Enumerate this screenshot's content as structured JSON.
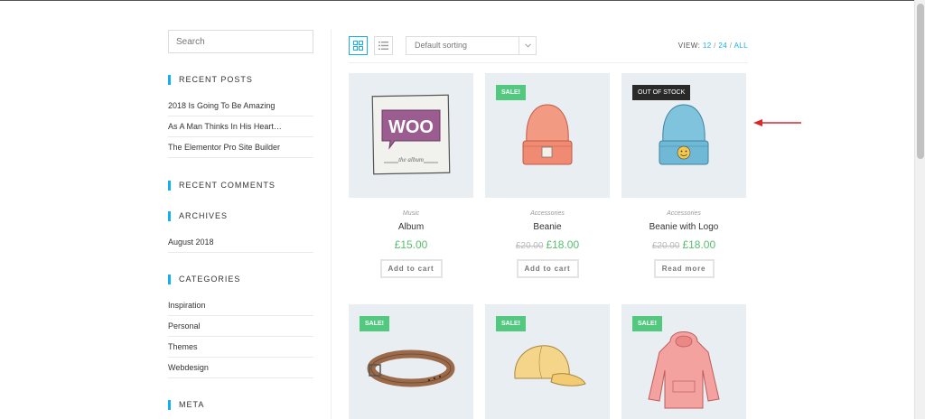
{
  "sidebar": {
    "search_placeholder": "Search",
    "recent_posts": {
      "title": "RECENT POSTS",
      "items": [
        "2018 Is Going To Be Amazing",
        "As A Man Thinks In His Heart…",
        "The Elementor Pro Site Builder"
      ]
    },
    "recent_comments": {
      "title": "RECENT COMMENTS"
    },
    "archives": {
      "title": "ARCHIVES",
      "items": [
        "August 2018"
      ]
    },
    "categories": {
      "title": "CATEGORIES",
      "items": [
        "Inspiration",
        "Personal",
        "Themes",
        "Webdesign"
      ]
    },
    "meta": {
      "title": "META"
    }
  },
  "toolbar": {
    "grid_icon": "grid-view-icon",
    "list_icon": "list-view-icon",
    "sort_value": "Default sorting",
    "view_label": "VIEW:",
    "view_options": [
      "12",
      "24",
      "ALL"
    ],
    "separator": "/"
  },
  "products": [
    {
      "category": "Music",
      "title": "Album",
      "price": "£15.00",
      "button": "Add to cart"
    },
    {
      "badge": "SALE!",
      "category": "Accessories",
      "title": "Beanie",
      "old_price": "£20.00",
      "price": "£18.00",
      "button": "Add to cart"
    },
    {
      "badge": "OUT OF STOCK",
      "category": "Accessories",
      "title": "Beanie with Logo",
      "old_price": "£20.00",
      "price": "£18.00",
      "button": "Read more"
    },
    {
      "badge": "SALE!"
    },
    {
      "badge": "SALE!"
    },
    {
      "badge": "SALE!"
    }
  ],
  "album_logo_text": "WOO",
  "album_subtext": "the album",
  "colors": {
    "accent": "#13aff0",
    "price": "#57bf6d",
    "sale_badge": "#52c97f",
    "arrow": "#d9262b"
  }
}
